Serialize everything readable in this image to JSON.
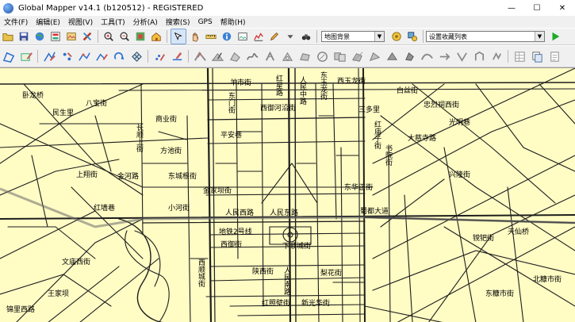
{
  "window": {
    "title": "Global Mapper v14.1 (b120512) - REGISTERED",
    "minimize": "—",
    "maximize": "☐",
    "close": "✕"
  },
  "menu": [
    "文件(F)",
    "编辑(E)",
    "视图(V)",
    "工具(T)",
    "分析(A)",
    "搜索(S)",
    "GPS",
    "帮助(H)"
  ],
  "toolbar1": {
    "layer_select": "地图背景",
    "layer_select_arrow": "▼",
    "view_select": "设置收藏列表",
    "view_select_arrow": "▼"
  },
  "map": {
    "labels": [
      {
        "text": "羊市街"
      },
      {
        "text": "西玉龙街"
      },
      {
        "text": "红星路"
      },
      {
        "text": "白丝街"
      },
      {
        "text": "东玉龙街"
      },
      {
        "text": "西御河沿街"
      },
      {
        "text": "三多里"
      },
      {
        "text": "忠烈祠西街"
      },
      {
        "text": "光明巷"
      },
      {
        "text": "民生里"
      },
      {
        "text": "八宝街"
      },
      {
        "text": "卧龙桥"
      },
      {
        "text": "平安巷"
      },
      {
        "text": "红庙子街"
      },
      {
        "text": "大慈寺路"
      },
      {
        "text": "商业街"
      },
      {
        "text": "方池街"
      },
      {
        "text": "金河路"
      },
      {
        "text": "东城根街"
      },
      {
        "text": "兴隆街"
      },
      {
        "text": "金家坝街"
      },
      {
        "text": "东华正街"
      },
      {
        "text": "人民西路"
      },
      {
        "text": "人民东路"
      },
      {
        "text": "蜀都大道"
      },
      {
        "text": "地铁2号线"
      },
      {
        "text": "西御街"
      },
      {
        "text": "下顺城街"
      },
      {
        "text": "文庙西街"
      },
      {
        "text": "陕西街"
      },
      {
        "text": "梨花街"
      },
      {
        "text": "红照壁街"
      },
      {
        "text": "新光华街"
      },
      {
        "text": "北糠市街"
      },
      {
        "text": "书院街"
      },
      {
        "text": "东糠市街"
      },
      {
        "text": "天仙桥"
      },
      {
        "text": "王家坝"
      },
      {
        "text": "西顺城街"
      },
      {
        "text": "上翔街"
      },
      {
        "text": "小河街"
      },
      {
        "text": "镋钯街"
      },
      {
        "text": "人民南路"
      },
      {
        "text": "人民中路"
      },
      {
        "text": "锦里西路"
      },
      {
        "text": "红墙巷"
      },
      {
        "text": "长顺上街"
      },
      {
        "text": "东门街"
      }
    ]
  }
}
